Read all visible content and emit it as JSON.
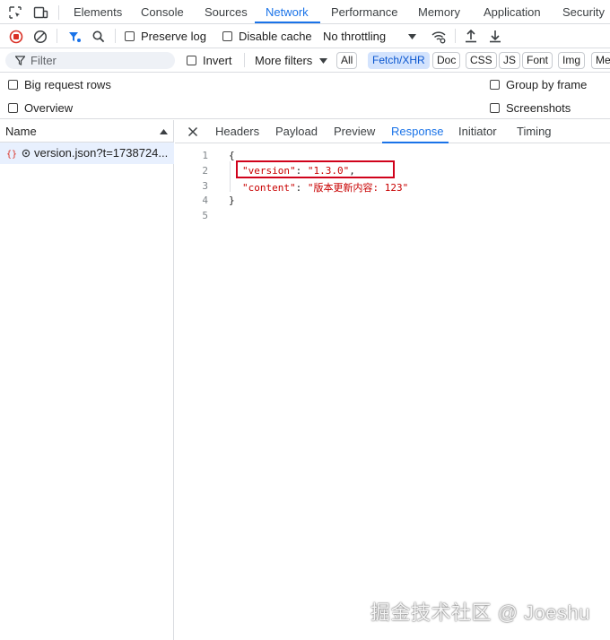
{
  "devtools": {
    "tabs": [
      "Elements",
      "Console",
      "Sources",
      "Network",
      "Performance",
      "Memory",
      "Application",
      "Security"
    ],
    "active_tab": "Network"
  },
  "toolbar": {
    "preserve_log": "Preserve log",
    "disable_cache": "Disable cache",
    "throttling": "No throttling"
  },
  "filter": {
    "placeholder": "Filter",
    "invert": "Invert",
    "more_filters": "More filters",
    "chips": [
      "All",
      "Fetch/XHR",
      "Doc",
      "CSS",
      "JS",
      "Font",
      "Img",
      "Me"
    ],
    "active_chip": "Fetch/XHR"
  },
  "options": {
    "big_request_rows": "Big request rows",
    "overview": "Overview",
    "group_by_frame": "Group by frame",
    "screenshots": "Screenshots"
  },
  "requests": {
    "header": "Name",
    "items": [
      {
        "name": "version.json?t=1738724..."
      }
    ]
  },
  "detail": {
    "tabs": [
      "Headers",
      "Payload",
      "Preview",
      "Response",
      "Initiator",
      "Timing"
    ],
    "active_tab": "Response",
    "lines": [
      "1",
      "2",
      "3",
      "4",
      "5"
    ],
    "code": {
      "open": "{",
      "version_key": "\"version\"",
      "version_val": "\"1.3.0\"",
      "content_key": "\"content\"",
      "content_val": "\"版本更新内容: 123\"",
      "close": "}"
    }
  },
  "watermark": "掘金技术社区 @ Joeshu",
  "colors": {
    "accent": "#1a73e8",
    "record_red": "#d93025",
    "highlight_box": "#d0021b",
    "string": "#c80000",
    "key": "#881280"
  }
}
